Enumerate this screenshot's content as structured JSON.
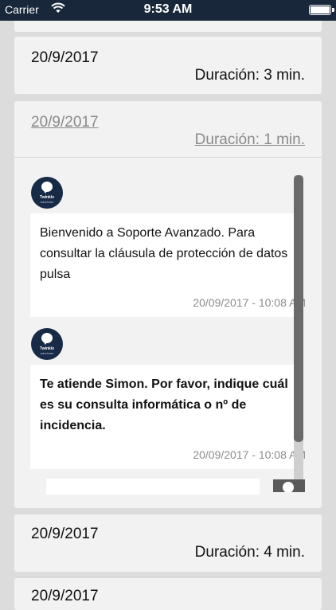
{
  "status_bar": {
    "carrier": "Carrier",
    "time": "9:53 AM"
  },
  "conversations": [
    {
      "date": "20/9/2017",
      "duration": "Duración: 3 min."
    },
    {
      "date": "20/9/2017",
      "duration": "Duración: 1 min."
    },
    {
      "date": "20/9/2017",
      "duration": "Duración: 4 min."
    },
    {
      "date": "20/9/2017"
    }
  ],
  "chat": {
    "avatar_brand": "Twinkle",
    "avatar_sub": "soluciones",
    "messages": [
      {
        "text": "Bienvenido a Soporte Avanzado. Para consultar la cláusula de protección de datos pulsa",
        "timestamp": "20/09/2017 - 10:08 AM"
      },
      {
        "text": "Te atiende Simon. Por favor, indique cuál es su consulta informática o nº de incidencia.",
        "timestamp": "20/09/2017 - 10:08 AM"
      }
    ],
    "input_value": ""
  },
  "colors": {
    "status_bar_bg": "#18273a",
    "page_bg": "#dcdcdc",
    "card_bg": "#f2f2f2",
    "avatar_bg": "#172a46"
  },
  "icons": {
    "wifi": "wifi-icon",
    "battery": "battery-icon",
    "avatar": "chat-bubble-logo-icon",
    "send": "send-icon"
  }
}
